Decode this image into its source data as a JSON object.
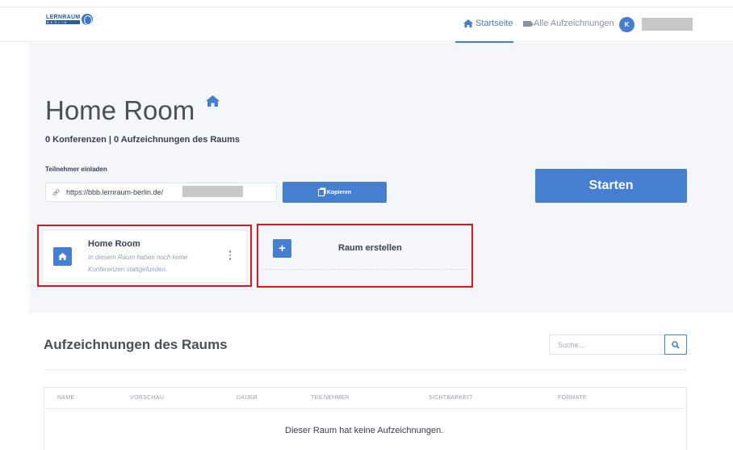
{
  "header": {
    "logo_text": "LERNRAUM",
    "logo_sub": "BERLIN",
    "nav_home": "Startseite",
    "nav_recordings": "Alle Aufzeichnungen",
    "avatar_initial": "K"
  },
  "room": {
    "title": "Home Room",
    "stats": "0 Konferenzen | 0 Aufzeichnungen des Raums",
    "invite_label": "Teilnehmer einladen",
    "invite_url": "https://bbb.lernraum-berlin.de/",
    "copy_label": "Kopieren",
    "start_label": "Starten"
  },
  "cards": {
    "home_title": "Home Room",
    "home_subtitle": "In diesem Raum haben noch keine Konferenzen stattgefunden.",
    "create_label": "Raum erstellen",
    "create_icon": "+"
  },
  "recordings": {
    "title": "Aufzeichnungen des Raums",
    "search_placeholder": "Suche...",
    "columns": [
      "NAME",
      "VORSCHAU",
      "DAUER",
      "TEILNEHMER",
      "SICHTBARKEIT",
      "FORMATE"
    ],
    "empty_message": "Dieser Raum hat keine Aufzeichnungen."
  },
  "colors": {
    "accent": "#467fcf",
    "highlight": "#e3141c",
    "hero_bg": "#f4f6fa"
  },
  "icons": {
    "home": "home-icon",
    "video": "video-camera-icon",
    "link": "link-icon",
    "copy": "copy-icon",
    "search": "search-icon",
    "more": "more-vertical-icon",
    "plus": "plus-icon"
  }
}
